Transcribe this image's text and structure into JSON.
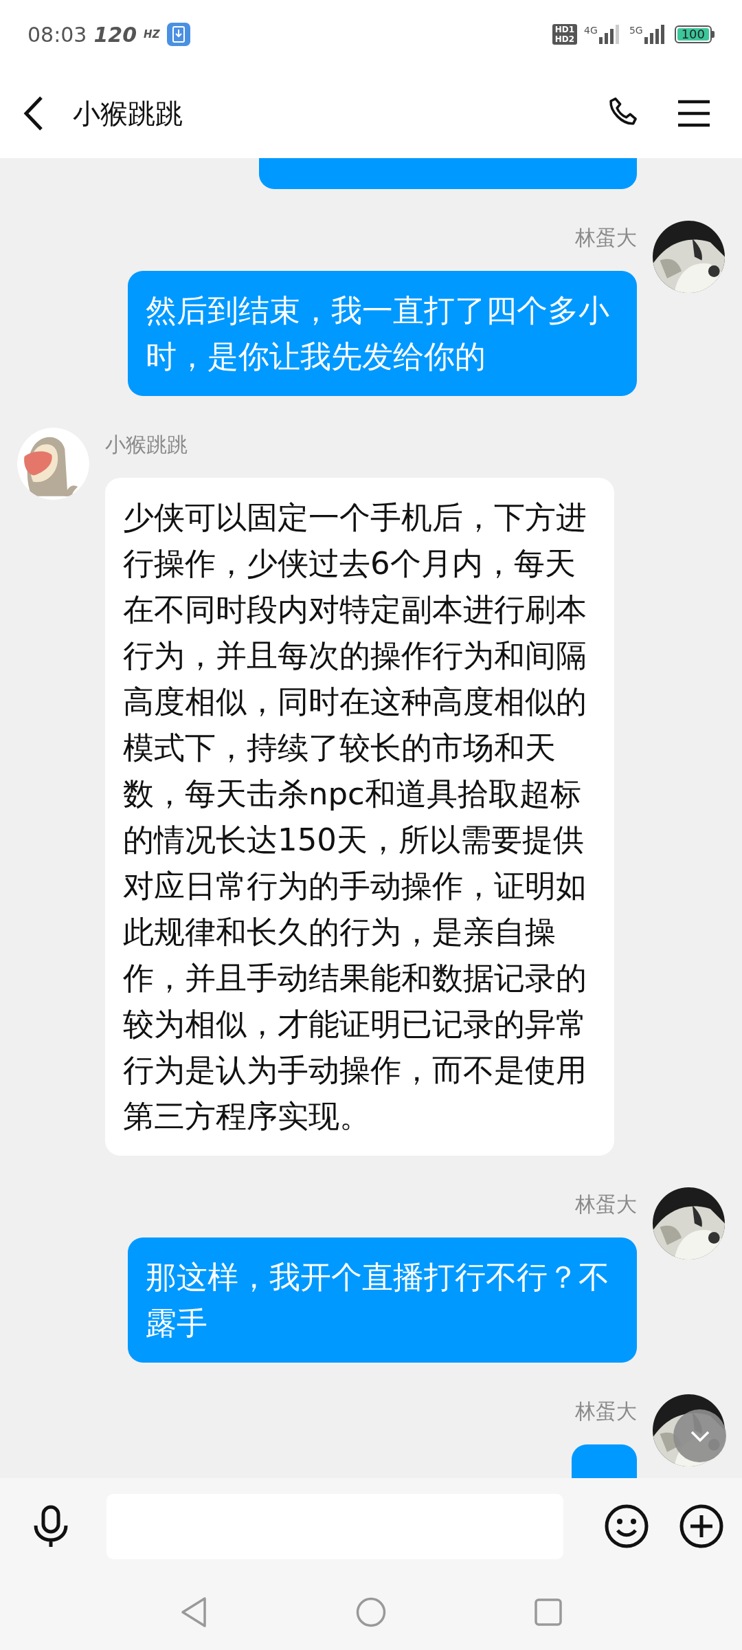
{
  "status_bar": {
    "time": "08:03",
    "refresh_rate": "120",
    "refresh_unit": "HZ",
    "sim_badge": [
      "HD1",
      "HD2"
    ],
    "network_1": "4G",
    "network_2": "5G",
    "battery": "100"
  },
  "header": {
    "title": "小猴跳跳"
  },
  "messages": [
    {
      "kind": "outgoing_partial"
    },
    {
      "kind": "outgoing",
      "sender": "林蛋大",
      "text": "然后到结束，我一直打了四个多小时，是你让我先发给你的"
    },
    {
      "kind": "incoming",
      "sender": "小猴跳跳",
      "text": "少侠可以固定一个手机后，下方进行操作，少侠过去6个月内，每天在不同时段内对特定副本进行刷本行为，并且每次的操作行为和间隔高度相似，同时在这种高度相似的模式下，持续了较长的市场和天数，每天击杀npc和道具拾取超标的情况长达150天，所以需要提供对应日常行为的手动操作，证明如此规律和长久的行为，是亲自操作，并且手动结果能和数据记录的较为相似，才能证明已记录的异常行为是认为手动操作，而不是使用第三方程序实现。"
    },
    {
      "kind": "outgoing",
      "sender": "林蛋大",
      "text": "那这样，我开个直播打行不行？不露手"
    },
    {
      "kind": "outgoing_cut",
      "sender": "林蛋大"
    }
  ]
}
